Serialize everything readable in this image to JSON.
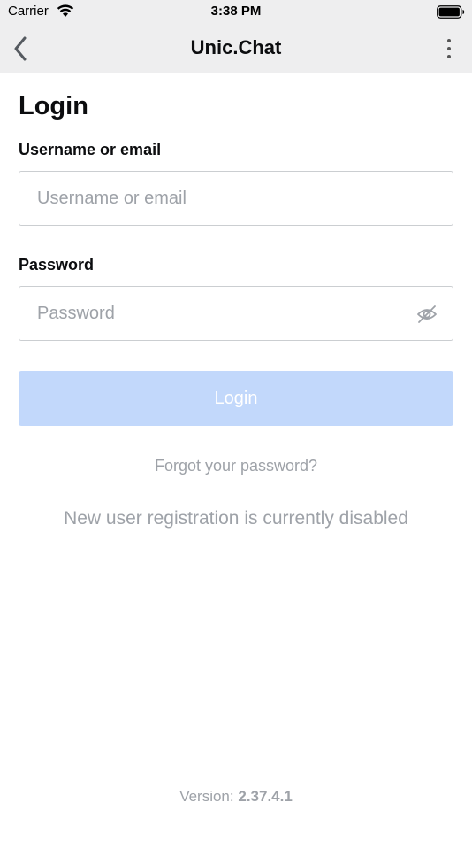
{
  "status_bar": {
    "carrier": "Carrier",
    "time": "3:38 PM",
    "icons": [
      "wifi-icon",
      "battery-icon"
    ]
  },
  "nav": {
    "title": "Unic.Chat",
    "back_icon": "chevron-left-icon",
    "more_icon": "more-vertical-icon"
  },
  "form": {
    "title": "Login",
    "username": {
      "label": "Username or email",
      "placeholder": "Username or email",
      "value": ""
    },
    "password": {
      "label": "Password",
      "placeholder": "Password",
      "value": "",
      "toggle_icon": "eye-off-icon"
    },
    "submit_label": "Login",
    "forgot_password": "Forgot your password?",
    "registration_notice": "New user registration is currently disabled"
  },
  "footer": {
    "version_label": "Version:",
    "version_number": "2.37.4.1"
  },
  "colors": {
    "nav_background": "#eeeeef",
    "button_disabled": "#c2d8fb",
    "muted_text": "#9ea2a8",
    "input_border": "#cbced1"
  }
}
